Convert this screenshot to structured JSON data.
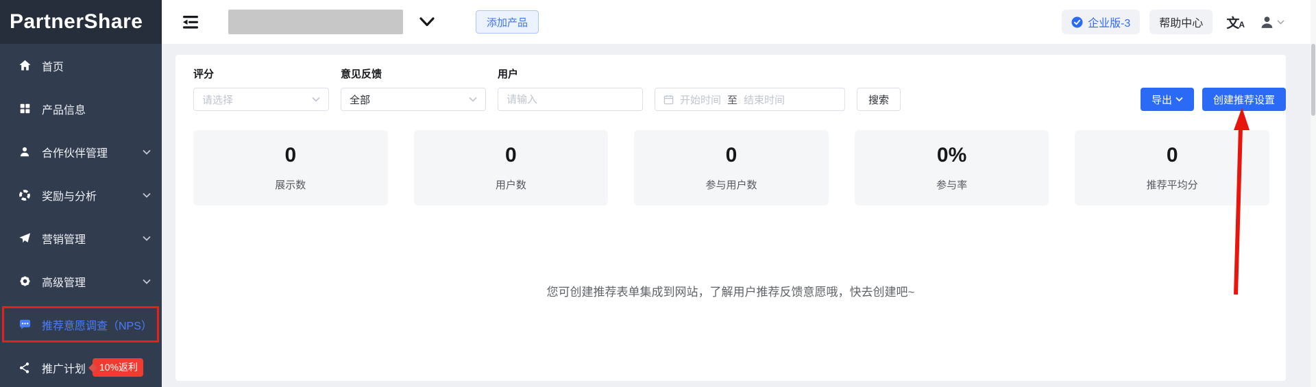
{
  "brand": {
    "logo_text": "PartnerShare"
  },
  "sidebar": {
    "items": [
      {
        "label": "首页",
        "icon": "home-icon"
      },
      {
        "label": "产品信息",
        "icon": "products-grid-icon"
      },
      {
        "label": "合作伙伴管理",
        "icon": "partners-user-icon",
        "expandable": true
      },
      {
        "label": "奖励与分析",
        "icon": "rewards-lifebuoy-icon",
        "expandable": true
      },
      {
        "label": "营销管理",
        "icon": "marketing-send-icon",
        "expandable": true
      },
      {
        "label": "高级管理",
        "icon": "advanced-gear-icon",
        "expandable": true
      },
      {
        "label": "推荐意愿调查（NPS）",
        "icon": "nps-chat-icon",
        "active": true
      },
      {
        "label": "推广计划",
        "icon": "promotion-share-icon",
        "badge": "10%返利"
      }
    ]
  },
  "topbar": {
    "collapse_icon": "collapse-menu-icon",
    "add_product_label": "添加产品",
    "plan_badge": "企业版-3",
    "plan_icon": "check-circle-icon",
    "help_center": "帮助中心",
    "language_icon": "translate-icon",
    "account_icon": "user-avatar-icon"
  },
  "filters": {
    "rating_label": "评分",
    "rating_placeholder": "请选择",
    "feedback_label": "意见反馈",
    "feedback_value": "全部",
    "user_label": "用户",
    "user_placeholder": "请输入",
    "date_start_placeholder": "开始时间",
    "date_separator": "至",
    "date_end_placeholder": "结束时间",
    "search_label": "搜索",
    "export_label": "导出",
    "create_label": "创建推荐设置"
  },
  "stats": [
    {
      "value": "0",
      "label": "展示数"
    },
    {
      "value": "0",
      "label": "用户数"
    },
    {
      "value": "0",
      "label": "参与用户数"
    },
    {
      "value": "0%",
      "label": "参与率"
    },
    {
      "value": "0",
      "label": "推荐平均分"
    }
  ],
  "empty_state": {
    "message": "您可创建推荐表单集成到网站，了解用户推荐反馈意愿哦，快去创建吧~"
  },
  "colors": {
    "sidebar_bg": "#313c4f",
    "logo_bg": "#272e3b",
    "active_blue": "#4a7dfa",
    "primary_blue": "#2a6af5",
    "annotation_red": "#e8150d",
    "badge_red": "#ef3b30"
  }
}
